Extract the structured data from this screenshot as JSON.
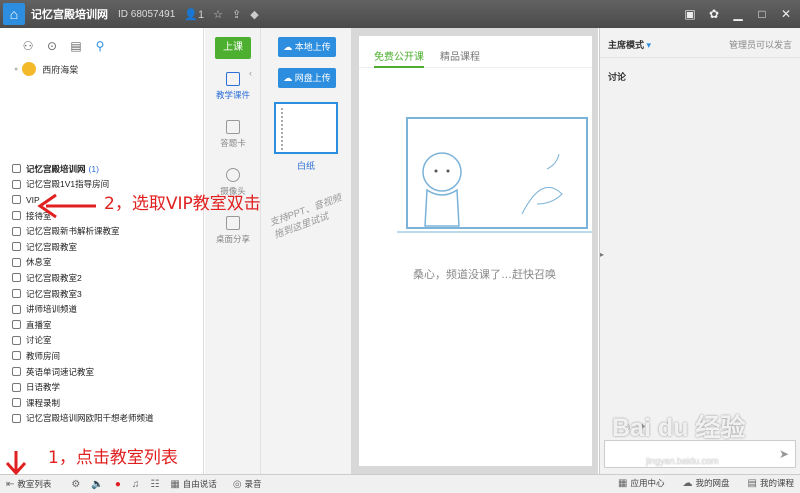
{
  "titlebar": {
    "title": "记忆宫殿培训网",
    "id": "ID 68057491",
    "user_count": "1"
  },
  "left": {
    "user_name": "西府海棠",
    "rooms": [
      {
        "label": "记忆宫殿培训网",
        "count": "(1)",
        "bold": true
      },
      {
        "label": "记忆宫殿1V1指导房间"
      },
      {
        "label": "VIP"
      },
      {
        "label": "接待室"
      },
      {
        "label": "记忆宫殿新书解析课教室"
      },
      {
        "label": "记忆宫殿教室"
      },
      {
        "label": "休息室"
      },
      {
        "label": "记忆宫殿教室2"
      },
      {
        "label": "记忆宫殿教室3"
      },
      {
        "label": "讲师培训频道"
      },
      {
        "label": "直播室"
      },
      {
        "label": "讨论室"
      },
      {
        "label": "教师房间"
      },
      {
        "label": "英语单词速记教室"
      },
      {
        "label": "日语教学"
      },
      {
        "label": "课程录制"
      },
      {
        "label": "记忆宫殿培训网欧阳千想老师频道"
      }
    ]
  },
  "toolbar": {
    "start_class": "上课",
    "courseware": "教学课件",
    "answer_card": "答题卡",
    "camera": "摄像头",
    "desktop_share": "桌面分享"
  },
  "files": {
    "local_upload": "本地上传",
    "cloud_upload": "网盘上传",
    "whiteboard": "白纸",
    "hint": "支持PPT、音视频拖到这里试试"
  },
  "content": {
    "tab_free": "免费公开课",
    "tab_premium": "精品课程",
    "empty_text": "桑心，频道没课了…赶快召唤"
  },
  "right": {
    "mode": "主席模式",
    "speak_note": "管理员可以发言",
    "discuss": "讨论"
  },
  "bottom": {
    "room_list": "教室列表",
    "free_talk": "自由说话",
    "record": "录音",
    "app_center": "应用中心",
    "my_cloud": "我的网盘",
    "my_courses": "我的课程"
  },
  "annotations": {
    "step1": "1，点击教室列表",
    "step2": "2，选取VIP教室双击"
  },
  "watermark": {
    "main": "Bai du 经验",
    "sub": "jingyan.baidu.com"
  },
  "colors": {
    "accent": "#2d8ee0",
    "green": "#4caf2f",
    "annotation": "#e02020"
  }
}
